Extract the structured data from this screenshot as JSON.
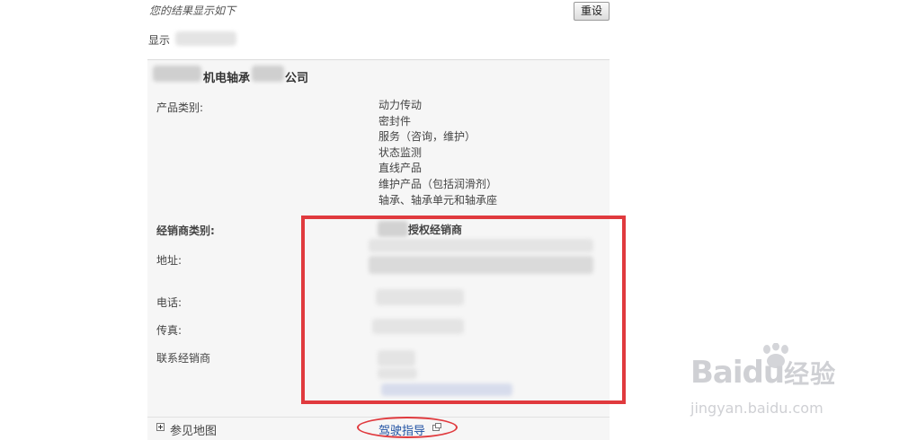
{
  "header": {
    "result_note": "您的结果显示如下",
    "reset_label": "重设",
    "display_label": "显示"
  },
  "company": {
    "name_visible": "机电轴承",
    "name_suffix": "公司"
  },
  "details": {
    "product_category_label": "产品类别:",
    "product_categories": [
      "动力传动",
      "密封件",
      "服务（咨询，维护）",
      "状态监测",
      "直线产品",
      "维护产品（包括润滑剂）",
      "轴承、轴承单元和轴承座"
    ],
    "dealer_type_label": "经销商类别:",
    "dealer_type_value": "授权经销商",
    "address_label": "地址:",
    "phone_label": "电话:",
    "fax_label": "传真:",
    "contact_label": "联系经销商"
  },
  "map": {
    "see_map_label": "参见地图",
    "driving_guide_label": "驾驶指导"
  },
  "colors": {
    "highlight": "#e03a3e",
    "link": "#1e50a2"
  },
  "watermark": {
    "brand": "Bai",
    "brand_tail": "du",
    "brand_cn": "经验",
    "url": "jingyan.baidu.com"
  }
}
